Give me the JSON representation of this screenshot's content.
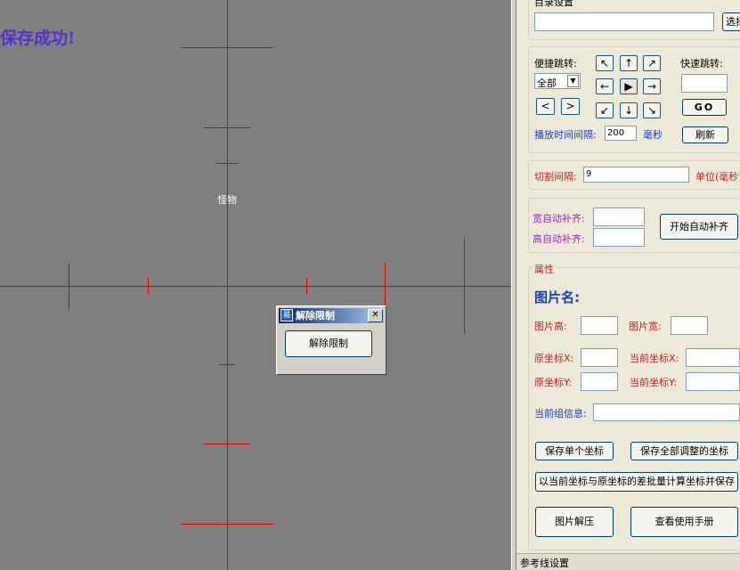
{
  "canvas": {
    "saved_message": "保存成功!",
    "monster_label": "怪物"
  },
  "dialog": {
    "title": "解除限制",
    "icon_glyph": "易",
    "close_glyph": "✕",
    "button_label": "解除限制"
  },
  "panel": {
    "dir_group_title": "目录设置",
    "select_dir_button": "选择",
    "quick_jump_label": "便捷跳转:",
    "fast_jump_label": "快速跳转:",
    "dropdown_value": "全部",
    "prev_button": "<",
    "next_button": ">",
    "arrows": [
      "↖",
      "↑",
      "↗",
      "←",
      "▶",
      "→",
      "↙",
      "↓",
      "↘"
    ],
    "go_button": "GO",
    "interval_label": "播放时间间隔:",
    "interval_value": "200",
    "interval_unit": "毫秒",
    "refresh_button": "刷新",
    "cut_interval_label": "切割间隔:",
    "cut_interval_value": "9",
    "cut_unit": "单位(毫秒)",
    "width_auto_label": "宽自动补齐:",
    "height_auto_label": "高自动补齐:",
    "start_auto_button": "开始自动补齐",
    "properties_title": "属性",
    "image_name_label": "图片名:",
    "image_height_label": "图片高:",
    "image_width_label": "图片宽:",
    "orig_x_label": "原坐标X:",
    "orig_y_label": "原坐标Y:",
    "cur_x_label": "当前坐标X:",
    "cur_y_label": "当前坐标Y:",
    "group_info_label": "当前组信息:",
    "save_single_button": "保存单个坐标",
    "save_all_button": "保存全部调整的坐标",
    "batch_button": "以当前坐标与原坐标的差批量计算坐标并保存",
    "decompress_button": "图片解压",
    "manual_button": "查看使用手册",
    "ref_line_title": "参考线设置"
  },
  "colors": {
    "canvas_bg": "#7f7f7f",
    "guide_line": "#e00000",
    "saved_text": "#5a2fd0",
    "label_blue": "#1a3cc8",
    "label_red": "#c81e1e",
    "label_purple": "#a020d0"
  }
}
